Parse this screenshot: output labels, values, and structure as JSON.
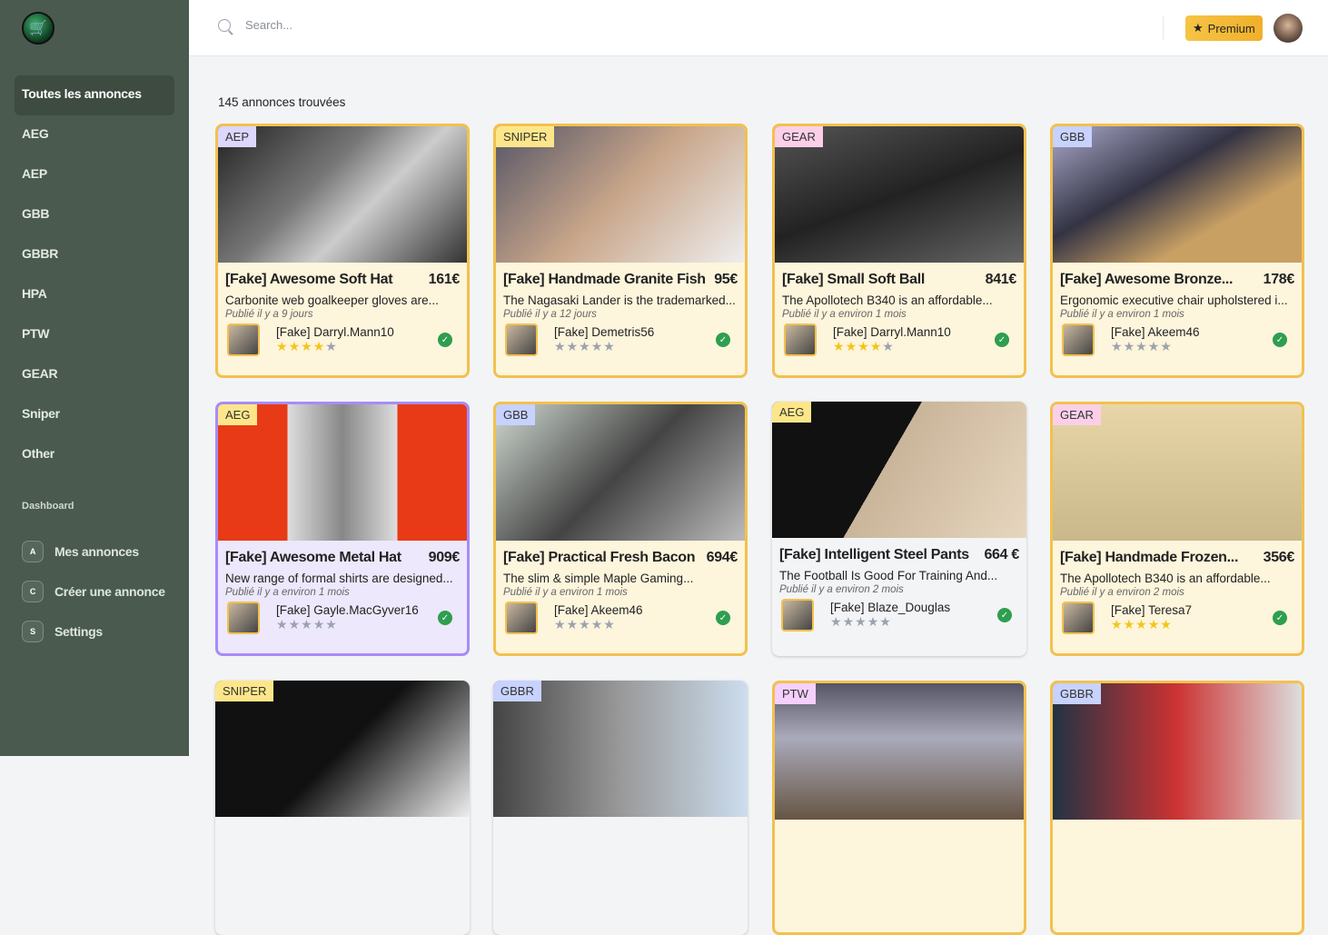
{
  "sidebar": {
    "logo": "shopping-cart-icon",
    "items": [
      {
        "label": "Toutes les annonces",
        "active": true
      },
      {
        "label": "AEG"
      },
      {
        "label": "AEP"
      },
      {
        "label": "GBB"
      },
      {
        "label": "GBBR"
      },
      {
        "label": "HPA"
      },
      {
        "label": "PTW"
      },
      {
        "label": "GEAR"
      },
      {
        "label": "Sniper"
      },
      {
        "label": "Other"
      }
    ],
    "section": "Dashboard",
    "dashboard": [
      {
        "icon": "A",
        "label": "Mes annonces"
      },
      {
        "icon": "C",
        "label": "Créer une annonce"
      },
      {
        "icon": "S",
        "label": "Settings"
      }
    ]
  },
  "topbar": {
    "search_placeholder": "Search...",
    "premium": "Premium",
    "premium_icon": "★"
  },
  "results": "145 annonces trouvées",
  "tag_colors": {
    "AEP": "#ddd6fe",
    "SNIPER": "#fde68a",
    "GEAR": "#fbcfe8",
    "GBB": "#c7d2fe",
    "AEG": "#fde68a",
    "GBBR": "#c7d2fe",
    "PTW": "#f5d0fe"
  },
  "cards": [
    {
      "tag": "AEP",
      "title": "[Fake] Awesome Soft Hat",
      "price": "161€",
      "desc": "Carbonite web goalkeeper gloves are...",
      "date": "Publié il y a 9 jours",
      "seller": "[Fake] Darryl.Mann10",
      "rating": 4,
      "style": "gold"
    },
    {
      "tag": "SNIPER",
      "title": "[Fake] Handmade Granite Fish",
      "price": "95€",
      "desc": "The Nagasaki Lander is the trademarked...",
      "date": "Publié il y a 12 jours",
      "seller": "[Fake] Demetris56",
      "rating": 0,
      "style": "gold"
    },
    {
      "tag": "GEAR",
      "title": "[Fake] Small Soft Ball",
      "price": "841€",
      "desc": "The Apollotech B340 is an affordable...",
      "date": "Publié il y a environ 1 mois",
      "seller": "[Fake] Darryl.Mann10",
      "rating": 4,
      "style": "gold"
    },
    {
      "tag": "GBB",
      "title": "[Fake] Awesome Bronze...",
      "price": "178€",
      "desc": "Ergonomic executive chair upholstered i...",
      "date": "Publié il y a environ 1 mois",
      "seller": "[Fake] Akeem46",
      "rating": 0,
      "style": "gold"
    },
    {
      "tag": "AEG",
      "title": "[Fake] Awesome Metal Hat",
      "price": "909€",
      "desc": "New range of formal shirts are designed...",
      "date": "Publié il y a environ 1 mois",
      "seller": "[Fake] Gayle.MacGyver16",
      "rating": 0,
      "style": "purple"
    },
    {
      "tag": "GBB",
      "title": "[Fake] Practical Fresh Bacon",
      "price": "694€",
      "desc": "The slim & simple Maple Gaming...",
      "date": "Publié il y a environ 1 mois",
      "seller": "[Fake] Akeem46",
      "rating": 0,
      "style": "gold"
    },
    {
      "tag": "AEG",
      "title": "[Fake] Intelligent Steel Pants",
      "price": "664 €",
      "desc": "The Football Is Good For Training And...",
      "date": "Publié il y a environ 2 mois",
      "seller": "[Fake] Blaze_Douglas",
      "rating": 0,
      "style": "plain"
    },
    {
      "tag": "GEAR",
      "title": "[Fake] Handmade Frozen...",
      "price": "356€",
      "desc": "The Apollotech B340 is an affordable...",
      "date": "Publié il y a environ 2 mois",
      "seller": "[Fake] Teresa7",
      "rating": 5,
      "style": "gold"
    },
    {
      "tag": "SNIPER",
      "style": "plain"
    },
    {
      "tag": "GBBR",
      "style": "plain"
    },
    {
      "tag": "PTW",
      "style": "gold"
    },
    {
      "tag": "GBBR",
      "style": "gold"
    }
  ]
}
